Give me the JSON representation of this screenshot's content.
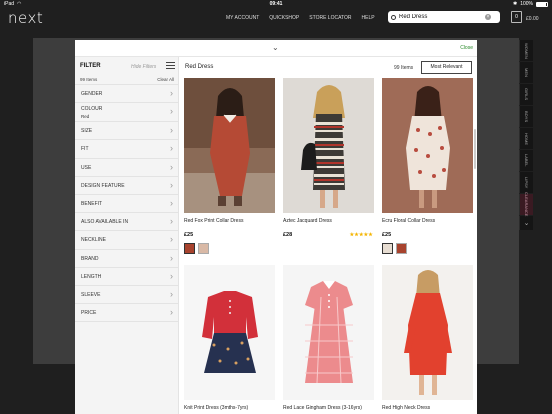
{
  "status_bar": {
    "carrier": "iPad",
    "time": "09:41",
    "battery": "100%"
  },
  "header": {
    "logo": "next",
    "nav": [
      "MY ACCOUNT",
      "QUICKSHOP",
      "STORE LOCATOR",
      "HELP"
    ],
    "search_value": "Red Dress",
    "bag_count": "0",
    "bag_total": "£0.00"
  },
  "side_tabs": [
    "WOMEN",
    "MEN",
    "GIRLS",
    "BOYS",
    "HOME",
    "LABEL",
    "LIPSY",
    "CLEARANCE"
  ],
  "modal": {
    "close_label": "Close"
  },
  "filter": {
    "title": "FILTER",
    "hide_label": "Hide Filters",
    "count": "99 Items",
    "clear_label": "Clear All",
    "rows": [
      {
        "label": "GENDER",
        "value": ""
      },
      {
        "label": "COLOUR",
        "value": "Red"
      },
      {
        "label": "SIZE",
        "value": ""
      },
      {
        "label": "FIT",
        "value": ""
      },
      {
        "label": "USE",
        "value": ""
      },
      {
        "label": "DESIGN FEATURE",
        "value": ""
      },
      {
        "label": "BENEFIT",
        "value": ""
      },
      {
        "label": "ALSO AVAILABLE IN",
        "value": ""
      },
      {
        "label": "NECKLINE",
        "value": ""
      },
      {
        "label": "BRAND",
        "value": ""
      },
      {
        "label": "LENGTH",
        "value": ""
      },
      {
        "label": "SLEEVE",
        "value": ""
      },
      {
        "label": "PRICE",
        "value": ""
      }
    ]
  },
  "results": {
    "title": "Red Dress",
    "count": "99 Items",
    "sort": "Most Relevant",
    "products": [
      {
        "name": "Red Fox Print Collar Dress",
        "price": "£25",
        "stars": "",
        "swatch_colors": [
          "#a8432e",
          "#d9b9a6"
        ]
      },
      {
        "name": "Aztec Jacquard Dress",
        "price": "£28",
        "stars": "★★★★★",
        "swatch_colors": []
      },
      {
        "name": "Ecru Floral Collar Dress",
        "price": "£25",
        "stars": "",
        "swatch_colors": [
          "#e7ddd2",
          "#a8432e"
        ]
      },
      {
        "name": "Knit Print Dress (3mths-7yrs)",
        "price": "",
        "stars": "",
        "swatch_colors": []
      },
      {
        "name": "Red Lace Gingham Dress (3-16yrs)",
        "price": "",
        "stars": "",
        "swatch_colors": []
      },
      {
        "name": "Red High Neck Dress",
        "price": "",
        "stars": "",
        "swatch_colors": []
      }
    ]
  },
  "colors": {
    "brand_bg": "#1f1f1f",
    "accent_close": "#2a8a2a",
    "star": "#f4b400"
  }
}
